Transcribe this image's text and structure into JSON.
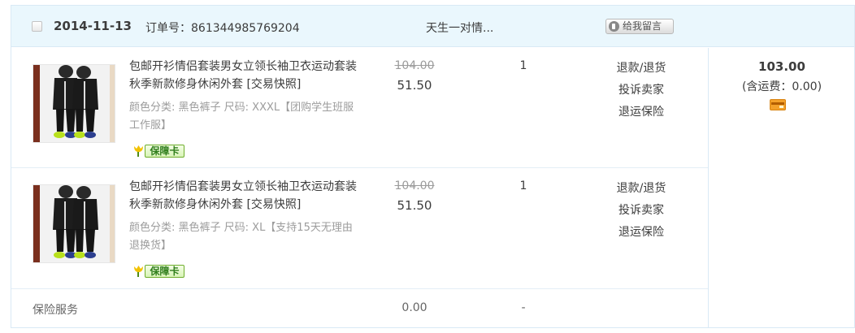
{
  "order": {
    "date": "2014-11-13",
    "order_no": "订单号：861344985769204",
    "seller": "天生一对情...",
    "message_button": "给我留言"
  },
  "items": [
    {
      "title": "包邮开衫情侣套装男女立领长袖卫衣运动套装秋季新款修身休闲外套",
      "snapshot": "[交易快照]",
      "sku": "颜色分类: 黑色裤子 尺码: XXXL【团购学生班服工作服】",
      "guarantee": "保障卡",
      "original_price": "104.00",
      "price": "51.50",
      "quantity": "1",
      "actions": [
        "退款/退货",
        "投诉卖家",
        "退运保险"
      ],
      "image": "black-tracksuit-couple-photo"
    },
    {
      "title": "包邮开衫情侣套装男女立领长袖卫衣运动套装秋季新款修身休闲外套",
      "snapshot": "[交易快照]",
      "sku": "颜色分类: 黑色裤子 尺码: XL【支持15天无理由退换货】",
      "guarantee": "保障卡",
      "original_price": "104.00",
      "price": "51.50",
      "quantity": "1",
      "actions": [
        "退款/退货",
        "投诉卖家",
        "退运保险"
      ],
      "image": "black-tracksuit-couple-photo"
    }
  ],
  "insurance": {
    "label": "保险服务",
    "price": "0.00",
    "quantity": "-"
  },
  "total": {
    "amount": "103.00",
    "shipping": "(含运费：0.00)",
    "icon": "bank-card-icon"
  },
  "colors": {
    "header_bg": "#eaf7fd",
    "border": "#d9e9f5",
    "guarantee_green": "#6fae2d",
    "card_orange": "#f3a12a"
  }
}
